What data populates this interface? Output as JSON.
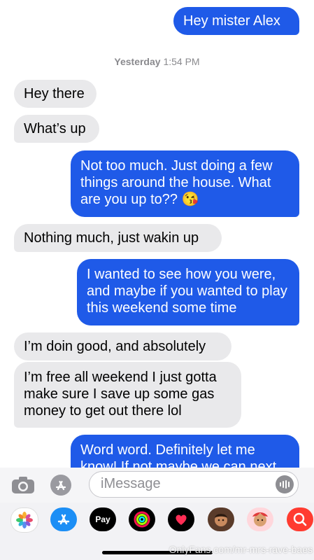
{
  "thread": {
    "timestamp_day": "Yesterday",
    "timestamp_time": "1:54 PM",
    "messages": [
      {
        "from": "me",
        "text": "Hey mister Alex"
      },
      {
        "from": "them",
        "text": "Hey there"
      },
      {
        "from": "them",
        "text": "What’s up"
      },
      {
        "from": "me",
        "text": "Not too much. Just doing a few things around the house. What are you up to?? 😘"
      },
      {
        "from": "them",
        "text": "Nothing much, just wakin up"
      },
      {
        "from": "me",
        "text": "I wanted to see how you were, and maybe if you wanted to play this weekend some time"
      },
      {
        "from": "them",
        "text": "I’m doin good, and absolutely"
      },
      {
        "from": "them",
        "text": "I’m free all weekend I just gotta make sure I save up some gas money to get out there lol"
      },
      {
        "from": "me",
        "text": "Word word. Definitely let me know! If not maybe we can next"
      }
    ]
  },
  "input": {
    "placeholder": "iMessage",
    "camera_icon": "camera-icon",
    "apps_icon": "app-store-icon",
    "voice_icon": "audio-waveform-icon"
  },
  "app_drawer": {
    "apps": [
      {
        "name": "photos-icon"
      },
      {
        "name": "app-store-icon"
      },
      {
        "name": "apple-pay-icon",
        "label": "Pay"
      },
      {
        "name": "activity-icon"
      },
      {
        "name": "digital-touch-icon"
      },
      {
        "name": "memoji-icon"
      },
      {
        "name": "memoji-stickers-icon"
      },
      {
        "name": "web-search-icon"
      }
    ]
  },
  "watermark": "OnlyFans.com/mr-mrs-rave-baes",
  "colors": {
    "sent_bubble": "#1f5ae8",
    "received_bubble": "#e9e9eb",
    "timestamp": "#8a8a8e"
  }
}
